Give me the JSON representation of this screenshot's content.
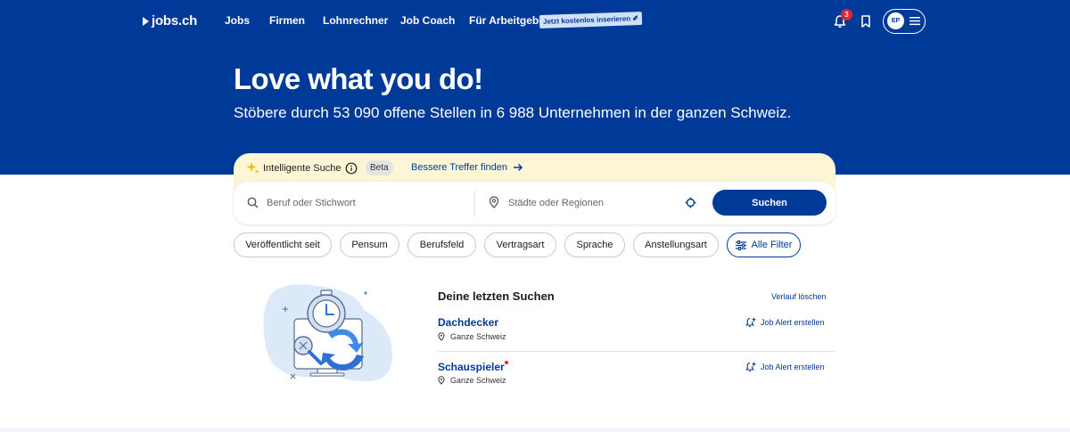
{
  "brand": {
    "logo_text": "jobs.ch",
    "primary_color": "#003a98",
    "accent_color": "#e0252b",
    "highlight_bg": "#fcf6d6"
  },
  "nav": {
    "items": [
      {
        "label": "Jobs"
      },
      {
        "label": "Firmen"
      },
      {
        "label": "Lohnrechner"
      },
      {
        "label": "Job Coach"
      },
      {
        "label": "Für Arbeitgeber"
      }
    ],
    "promo_label": "Jetzt kostenlos inserieren"
  },
  "header_actions": {
    "notification_count": "3",
    "avatar_initials": "EP",
    "icons": [
      "bell-icon",
      "bookmark-icon",
      "menu-icon"
    ]
  },
  "hero": {
    "title": "Love what you do!",
    "subtitle": "Stöbere durch 53 090 offene Stellen in 6 988 Unternehmen in der ganzen Schweiz."
  },
  "smart_search": {
    "label": "Intelligente Suche",
    "beta_label": "Beta",
    "link_label": "Bessere Treffer finden"
  },
  "search": {
    "keyword_placeholder": "Beruf oder Stichwort",
    "location_placeholder": "Städte oder Regionen",
    "button_label": "Suchen"
  },
  "filters": {
    "chips": [
      {
        "label": "Veröffentlicht seit"
      },
      {
        "label": "Pensum"
      },
      {
        "label": "Berufsfeld"
      },
      {
        "label": "Vertragsart"
      },
      {
        "label": "Sprache"
      },
      {
        "label": "Anstellungsart"
      }
    ],
    "all_label": "Alle Filter"
  },
  "recent": {
    "title": "Deine letzten Suchen",
    "clear_label": "Verlauf löschen",
    "items": [
      {
        "name": "Dachdecker",
        "location": "Ganze Schweiz",
        "alert_label": "Job Alert erstellen",
        "is_new": false
      },
      {
        "name": "Schauspieler",
        "location": "Ganze Schweiz",
        "alert_label": "Job Alert erstellen",
        "is_new": true
      }
    ]
  }
}
